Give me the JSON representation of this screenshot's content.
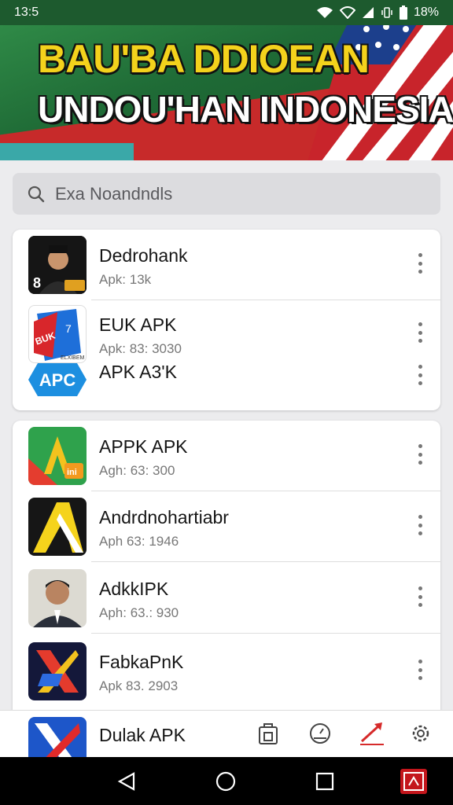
{
  "status_bar": {
    "time": "13:5",
    "battery": "18%",
    "icons": [
      "wifi-icon",
      "wifi-alt-icon",
      "signal-icon",
      "vibrate-icon",
      "battery-icon"
    ]
  },
  "banner": {
    "title_line1": "BAU'BA DDIOEAN",
    "title_line2": "UNDOU'HAN INDONESIA",
    "colors": {
      "title1": "#f4d21c",
      "title2": "#ffffff",
      "green": "#1f6b36",
      "red": "#c72a2a"
    }
  },
  "search": {
    "placeholder": "Exa Noandndls",
    "icon": "search-icon"
  },
  "group1": [
    {
      "name": "Dedrohank",
      "meta": "Apk: 13k",
      "icon": "profile-man-icon"
    },
    {
      "name": "EUK APK",
      "meta": "Apk: 83: 3030",
      "icon": "blue-red-logo-icon"
    },
    {
      "name": "APK A3'K",
      "meta": "",
      "icon": "apc-logo-icon",
      "icon_text": "APC"
    }
  ],
  "group2": [
    {
      "name": "APPK APK",
      "meta": "Agh: 63: 300",
      "icon": "green-a-logo-icon"
    },
    {
      "name": "Andrdnohartiabr",
      "meta": "Aph 63: 1946",
      "icon": "black-yellow-a-icon"
    },
    {
      "name": "AdkkIPK",
      "meta": "Aph: 63.: 930",
      "icon": "profile-man-suit-icon"
    },
    {
      "name": "FabkaPnK",
      "meta": "Apk 83. 2903",
      "icon": "blue-x-logo-icon"
    }
  ],
  "peek_row": {
    "name": "Dulak APK",
    "icon": "red-blue-x-icon"
  },
  "bottom_tabs": [
    "store-icon",
    "dashboard-icon",
    "share-icon",
    "settings-icon"
  ],
  "nav": [
    "back-icon",
    "home-icon",
    "recents-icon",
    "screen-recorder-icon"
  ]
}
